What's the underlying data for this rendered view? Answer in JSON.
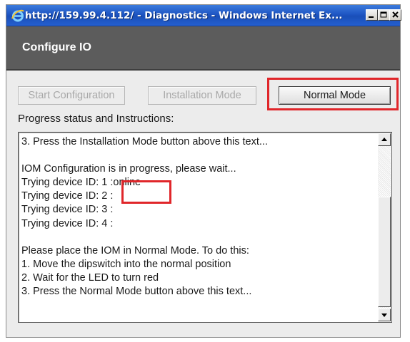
{
  "window": {
    "title": "http://159.99.4.112/ - Diagnostics - Windows Internet Ex...",
    "icon": "ie-icon",
    "controls": {
      "minimize": "minimize-icon",
      "maximize": "maximize-icon",
      "close": "close-icon"
    }
  },
  "dialog": {
    "title": "Configure IO"
  },
  "buttons": {
    "start_configuration": "Start Configuration",
    "installation_mode": "Installation Mode",
    "normal_mode": "Normal Mode"
  },
  "progress": {
    "label": "Progress status and Instructions:",
    "lines": [
      "3. Press the Installation Mode button above this text...",
      "",
      "IOM Configuration is in progress, please wait...",
      "Trying device ID: 1 :online",
      "Trying device ID: 2 :",
      "Trying device ID: 3 :",
      "Trying device ID: 4 :",
      "",
      "Please place the IOM in Normal Mode. To do this:",
      "1. Move the dipswitch into the normal position",
      "2. Wait for the LED to turn red",
      "3. Press the Normal Mode button above this text..."
    ]
  },
  "annotation_color": "#e0262a"
}
